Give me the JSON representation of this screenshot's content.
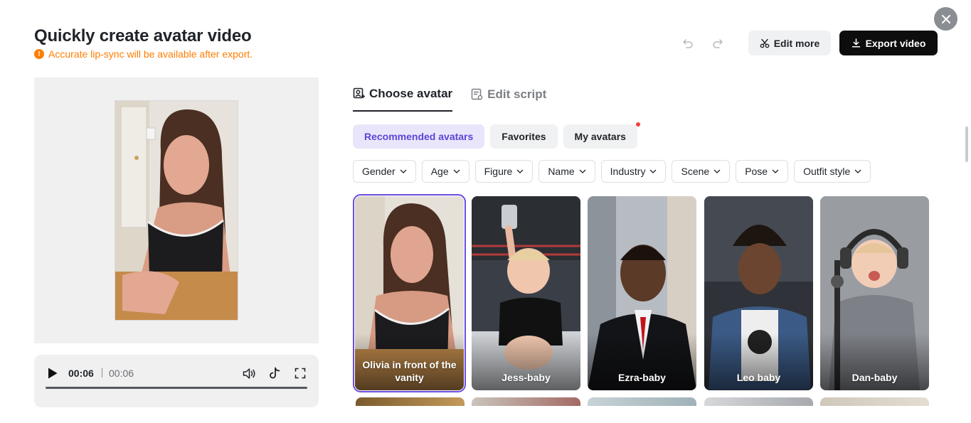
{
  "header": {
    "title": "Quickly create avatar video",
    "notice": "Accurate lip-sync will be available after export.",
    "edit_more_label": "Edit more",
    "export_label": "Export video"
  },
  "player": {
    "current_time": "00:06",
    "total_time": "00:06",
    "progress": 1.0
  },
  "tabs": [
    {
      "label": "Choose avatar",
      "icon": "avatar-icon",
      "active": true
    },
    {
      "label": "Edit script",
      "icon": "script-icon",
      "active": false
    }
  ],
  "subtabs": [
    {
      "label": "Recommended avatars",
      "active": true
    },
    {
      "label": "Favorites",
      "active": false
    },
    {
      "label": "My avatars",
      "active": false,
      "notification_dot": true
    }
  ],
  "filters": [
    "Gender",
    "Age",
    "Figure",
    "Name",
    "Industry",
    "Scene",
    "Pose",
    "Outfit style"
  ],
  "avatars": [
    {
      "name": "Olivia in front of the vanity",
      "selected": true
    },
    {
      "name": "Jess-baby",
      "selected": false
    },
    {
      "name": "Ezra-baby",
      "selected": false
    },
    {
      "name": "Leo baby",
      "selected": false
    },
    {
      "name": "Dan-baby",
      "selected": false
    }
  ],
  "colors": {
    "accent": "#6a4de0",
    "notice": "#ff7d00",
    "export_bg": "#0d0d0d",
    "notification": "#f53f3f"
  }
}
